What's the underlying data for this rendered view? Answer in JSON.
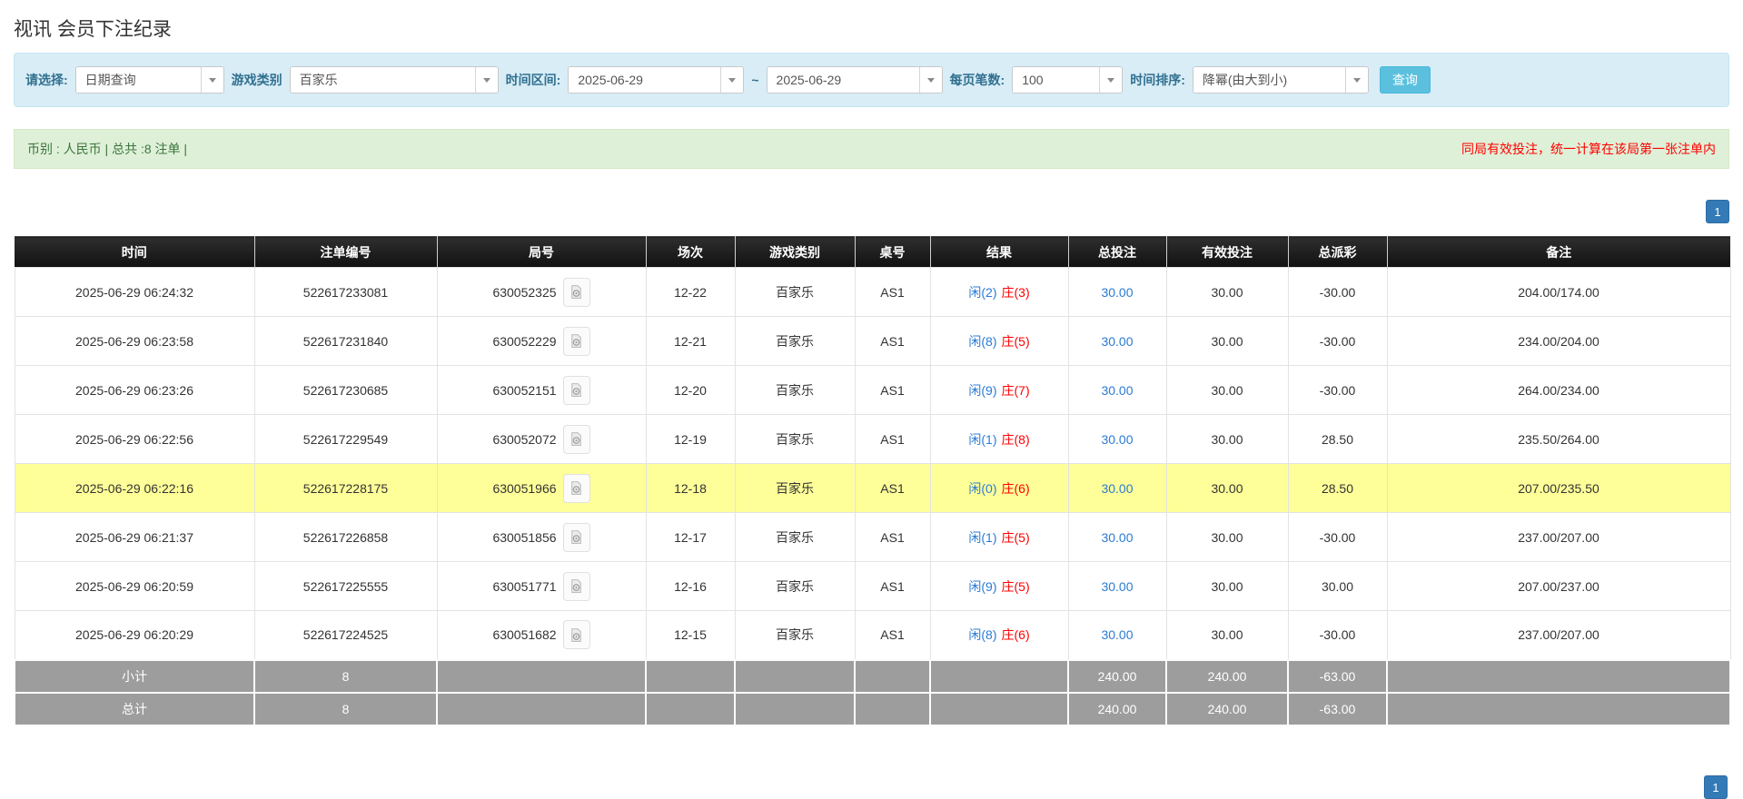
{
  "page": {
    "title": "视讯 会员下注纪录"
  },
  "filters": {
    "select_label": "请选择:",
    "select_value": "日期查询",
    "game_label": "游戏类别",
    "game_value": "百家乐",
    "range_label": "时间区间:",
    "date_from": "2025-06-29",
    "range_sep": "~",
    "date_to": "2025-06-29",
    "per_page_label": "每页笔数:",
    "per_page_value": "100",
    "sort_label": "时间排序:",
    "sort_value": "降幂(由大到小)",
    "query_button": "查询"
  },
  "info_bar": {
    "left": "币别 : 人民币 | 总共 :8 注单 |",
    "right": "同局有效投注，统一计算在该局第一张注单内"
  },
  "pagination": {
    "page": "1"
  },
  "table": {
    "headers": [
      "时间",
      "注单编号",
      "局号",
      "场次",
      "游戏类别",
      "桌号",
      "结果",
      "总投注",
      "有效投注",
      "总派彩",
      "备注"
    ],
    "rows": [
      {
        "time": "2025-06-29 06:24:32",
        "bet_id": "522617233081",
        "round_id": "630052325",
        "session": "12-22",
        "game": "百家乐",
        "table_no": "AS1",
        "result_player": "闲(2)",
        "result_banker": "庄(3)",
        "total_bet": "30.00",
        "valid_bet": "30.00",
        "payout": "-30.00",
        "remark": "204.00/174.00",
        "highlighted": false
      },
      {
        "time": "2025-06-29 06:23:58",
        "bet_id": "522617231840",
        "round_id": "630052229",
        "session": "12-21",
        "game": "百家乐",
        "table_no": "AS1",
        "result_player": "闲(8)",
        "result_banker": "庄(5)",
        "total_bet": "30.00",
        "valid_bet": "30.00",
        "payout": "-30.00",
        "remark": "234.00/204.00",
        "highlighted": false
      },
      {
        "time": "2025-06-29 06:23:26",
        "bet_id": "522617230685",
        "round_id": "630052151",
        "session": "12-20",
        "game": "百家乐",
        "table_no": "AS1",
        "result_player": "闲(9)",
        "result_banker": "庄(7)",
        "total_bet": "30.00",
        "valid_bet": "30.00",
        "payout": "-30.00",
        "remark": "264.00/234.00",
        "highlighted": false
      },
      {
        "time": "2025-06-29 06:22:56",
        "bet_id": "522617229549",
        "round_id": "630052072",
        "session": "12-19",
        "game": "百家乐",
        "table_no": "AS1",
        "result_player": "闲(1)",
        "result_banker": "庄(8)",
        "total_bet": "30.00",
        "valid_bet": "30.00",
        "payout": "28.50",
        "remark": "235.50/264.00",
        "highlighted": false
      },
      {
        "time": "2025-06-29 06:22:16",
        "bet_id": "522617228175",
        "round_id": "630051966",
        "session": "12-18",
        "game": "百家乐",
        "table_no": "AS1",
        "result_player": "闲(0)",
        "result_banker": "庄(6)",
        "total_bet": "30.00",
        "valid_bet": "30.00",
        "payout": "28.50",
        "remark": "207.00/235.50",
        "highlighted": true
      },
      {
        "time": "2025-06-29 06:21:37",
        "bet_id": "522617226858",
        "round_id": "630051856",
        "session": "12-17",
        "game": "百家乐",
        "table_no": "AS1",
        "result_player": "闲(1)",
        "result_banker": "庄(5)",
        "total_bet": "30.00",
        "valid_bet": "30.00",
        "payout": "-30.00",
        "remark": "237.00/207.00",
        "highlighted": false
      },
      {
        "time": "2025-06-29 06:20:59",
        "bet_id": "522617225555",
        "round_id": "630051771",
        "session": "12-16",
        "game": "百家乐",
        "table_no": "AS1",
        "result_player": "闲(9)",
        "result_banker": "庄(5)",
        "total_bet": "30.00",
        "valid_bet": "30.00",
        "payout": "30.00",
        "remark": "207.00/237.00",
        "highlighted": false
      },
      {
        "time": "2025-06-29 06:20:29",
        "bet_id": "522617224525",
        "round_id": "630051682",
        "session": "12-15",
        "game": "百家乐",
        "table_no": "AS1",
        "result_player": "闲(8)",
        "result_banker": "庄(6)",
        "total_bet": "30.00",
        "valid_bet": "30.00",
        "payout": "-30.00",
        "remark": "237.00/207.00",
        "highlighted": false
      }
    ],
    "subtotal": {
      "label": "小计",
      "count": "8",
      "total_bet": "240.00",
      "valid_bet": "240.00",
      "payout": "-63.00"
    },
    "total": {
      "label": "总计",
      "count": "8",
      "total_bet": "240.00",
      "valid_bet": "240.00",
      "payout": "-63.00"
    }
  },
  "colors": {
    "accent_blue": "#5bc0de",
    "link_blue": "#2b7bd4",
    "negative_red": "#ff0000",
    "highlight_yellow": "#ffff99",
    "panel_blue": "#d9edf7",
    "success_green": "#dff0d8"
  }
}
